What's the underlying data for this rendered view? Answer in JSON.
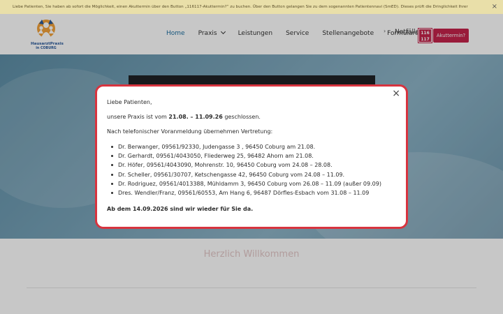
{
  "notice": {
    "text": "Liebe Patienten, Sie haben ab sofort die Möglichkeit, einen Akuttermin über den Button „116117-Akuttermin?“ zu buchen. Über den Button gelangen Sie zu dem sogenannten Patientennavi (SmED). Dieses prüft die Dringlichkeit Ihrer",
    "close_label": "×"
  },
  "logo": {
    "line1": "HausarztPraxis",
    "line2": "in COBURG"
  },
  "nav": {
    "items": [
      {
        "label": "Home",
        "active": true
      },
      {
        "label": "Praxis",
        "has_dropdown": true
      },
      {
        "label": "Leistungen"
      },
      {
        "label": "Service"
      },
      {
        "label": "Stellenangebote"
      },
      {
        "label": "Formulare"
      }
    ],
    "more_label": "›",
    "notfaelle": "Notfälle",
    "badge_top": "116",
    "badge_bottom": "117",
    "akuttermin_label": "Akuttermin?"
  },
  "welcome_text": "Herzlich Willkommen",
  "modal": {
    "close_label": "×",
    "greeting": "Liebe Patienten,",
    "closed_prefix": "unsere Praxis ist vom ",
    "closed_dates": "21.08. – 11.09.26",
    "closed_suffix": " geschlossen.",
    "vertretung_intro": "Nach telefonischer Voranmeldung übernehmen Vertretung:",
    "vertretungen": [
      "Dr. Berwanger, 09561/92330, Judengasse 3 , 96450 Coburg am 21.08.",
      "Dr. Gerhardt, 09561/4043050, Fliederweg 25, 96482 Ahorn am 21.08.",
      "Dr. Höfer, 09561/4043090, Mohrenstr. 10, 96450 Coburg vom 24.08 – 28.08.",
      "Dr. Scheller, 09561/30707, Ketschengasse 42, 96450 Coburg vom 24.08 – 11.09.",
      "Dr. Rodriguez, 09561/4013388, Mühldamm 3, 96450 Coburg vom 26.08 – 11.09 (außer 09.09)",
      "Dres. Wendler/Franz, 09561/60553, Am Hang 6, 96487 Dörfles-Esbach vom 31.08 – 11.09"
    ],
    "reopen": "Ab dem 14.09.2026 sind wir wieder für Sie da."
  },
  "colors": {
    "accent": "#c4234b",
    "modal_border": "#d8343f",
    "nav_active": "#1d6fa0",
    "notice_bg": "#e9dfa9"
  }
}
